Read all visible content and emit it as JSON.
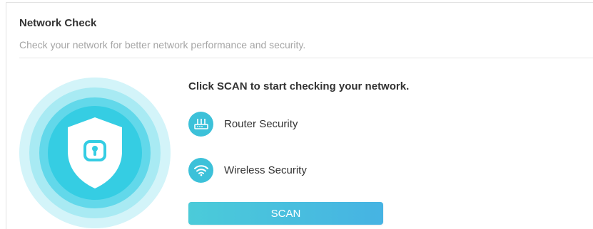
{
  "panel": {
    "title": "Network Check",
    "subtitle": "Check your network for better network performance and security."
  },
  "intro_text": "Click SCAN to start checking your network.",
  "checks": [
    {
      "label": "Router Security",
      "icon": "router-icon"
    },
    {
      "label": "Wireless Security",
      "icon": "wifi-icon"
    }
  ],
  "scan_button_label": "SCAN",
  "illustration_icon": "shield-lock-icon",
  "colors": {
    "accent": "#3cc1d9",
    "ring_outer": "#d3f4f9",
    "ring_middle": "#a8eaf3",
    "ring_inner": "#62d8ea",
    "core": "#35cde3",
    "button_start": "#4bcbd9",
    "button_end": "#46b3e3"
  }
}
